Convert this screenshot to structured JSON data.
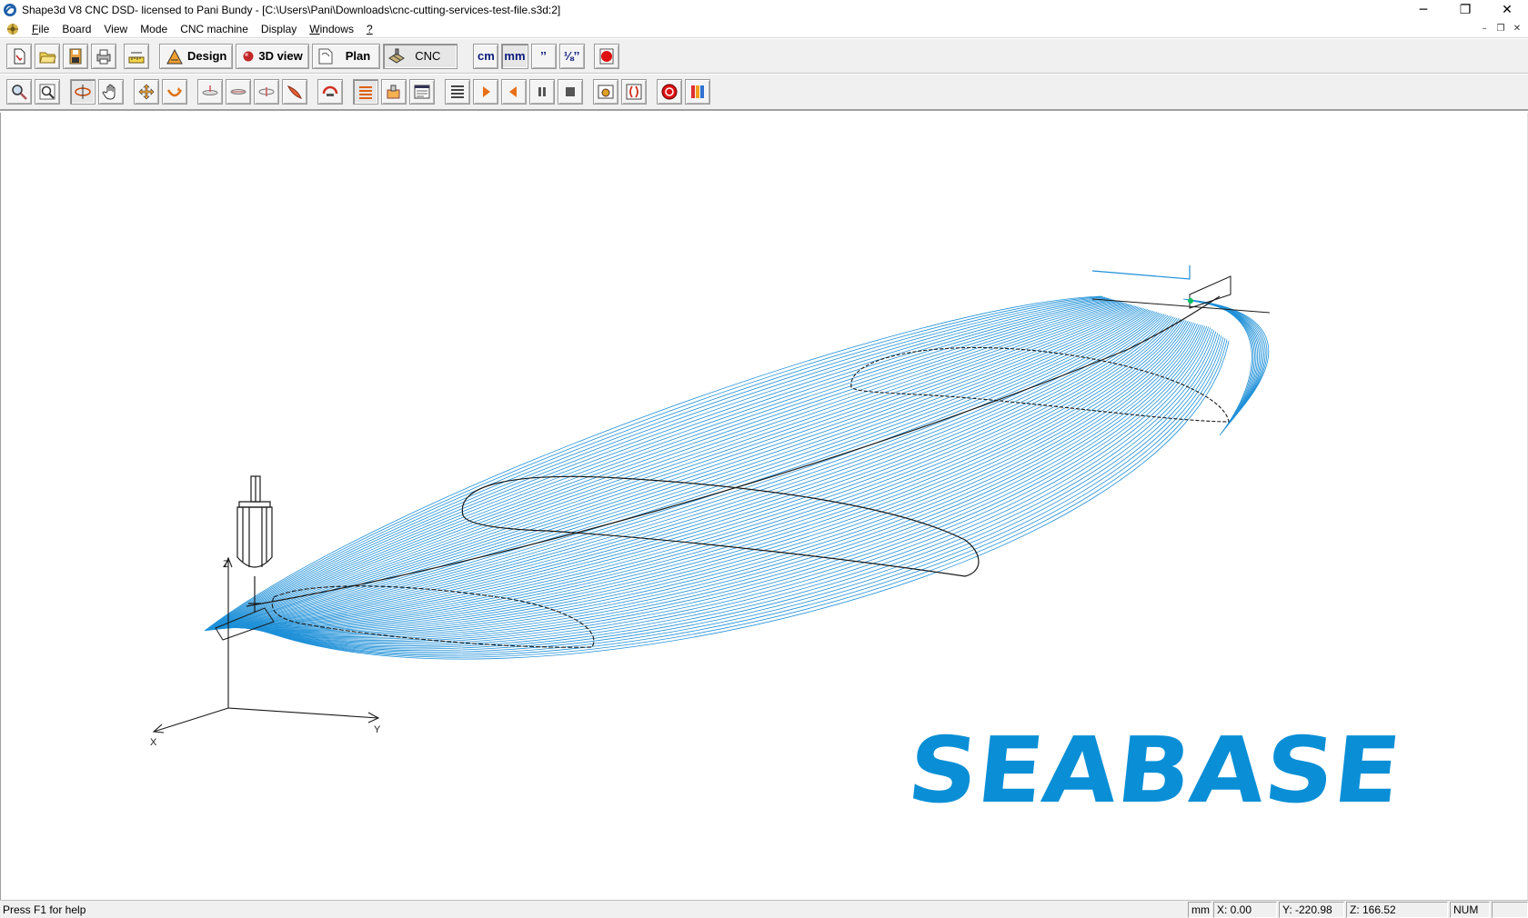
{
  "window": {
    "title": "Shape3d V8 CNC DSD- licensed to Pani Bundy - [C:\\Users\\Pani\\Downloads\\cnc-cutting-services-test-file.s3d:2]",
    "controls": {
      "minimize": "─",
      "restore": "❐",
      "close": "✕"
    }
  },
  "menu": {
    "items": [
      {
        "label_u": "F",
        "label_rest": "ile"
      },
      {
        "label_u": "",
        "label_rest": "Board"
      },
      {
        "label_u": "",
        "label_rest": "View"
      },
      {
        "label_u": "",
        "label_rest": "Mode"
      },
      {
        "label_u": "",
        "label_rest": "CNC machine"
      },
      {
        "label_u": "",
        "label_rest": "Display"
      },
      {
        "label_u": "W",
        "label_rest": "indows"
      },
      {
        "label_u": "?",
        "label_rest": ""
      }
    ],
    "mdi_controls": {
      "minimize": "–",
      "restore": "❐",
      "close": "✕"
    }
  },
  "toolbar_main": {
    "mode_buttons": {
      "design": "Design",
      "view3d": "3D view",
      "plan": "Plan",
      "cnc": "CNC"
    },
    "unit_buttons": {
      "cm": "cm",
      "mm": "mm",
      "inch": "’’",
      "fraction": "⅛’’"
    },
    "help_glyph": "?"
  },
  "viewport": {
    "axes": {
      "x": "X",
      "y": "Y",
      "z": "Z"
    },
    "logo_text": "SEABASE",
    "colors": {
      "toolpath": "#1e90d8",
      "logo": "#0a8fd6",
      "outline": "#1a1a1a"
    }
  },
  "statusbar": {
    "help": "Press F1 for help",
    "unit": "mm",
    "x": "X: 0.00",
    "y": "Y: -220.98",
    "z": "Z: 166.52",
    "num": "NUM"
  }
}
